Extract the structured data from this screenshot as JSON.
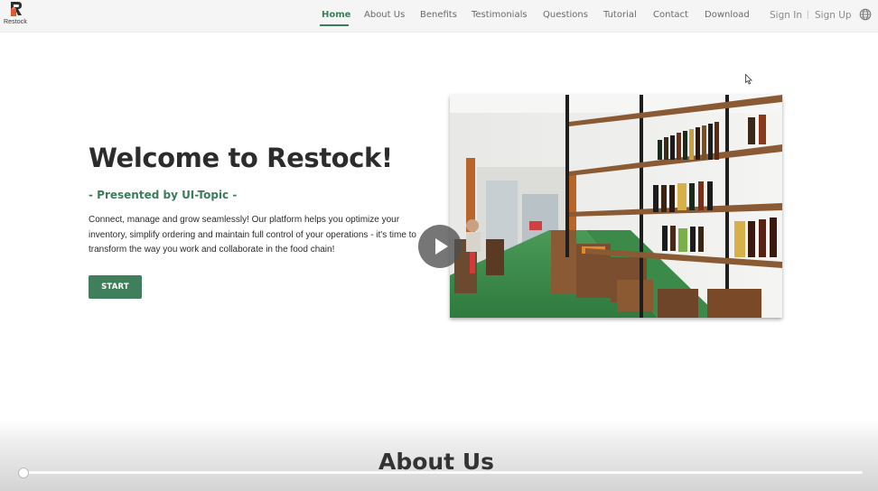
{
  "brand": {
    "name": "Restock",
    "colors": {
      "accent": "#3a7d5a",
      "logo_orange": "#e2572b",
      "logo_dark": "#2e2e2e"
    }
  },
  "nav": {
    "links": [
      {
        "label": "Home",
        "active": true
      },
      {
        "label": "About Us"
      },
      {
        "label": "Benefits"
      },
      {
        "label": "Testimonials"
      },
      {
        "label": "Questions"
      },
      {
        "label": "Tutorial"
      },
      {
        "label": "Contact"
      },
      {
        "label": "Download"
      }
    ],
    "sign_in": "Sign In",
    "separator": "|",
    "sign_up": "Sign Up",
    "language_icon": "globe-icon"
  },
  "hero": {
    "title": "Welcome to Restock!",
    "subtitle": "- Presented by UI-Topic -",
    "description": "Connect, manage and grow seamlessly! Our platform helps you optimize your inventory, simplify ordering and maintain full control of your operations - it's time to transform the way you work and collaborate in the food chain!",
    "start_button": "START",
    "video": {
      "play_icon": "play-icon"
    }
  },
  "about": {
    "title": "About Us"
  },
  "player": {
    "progress": 0.0
  }
}
